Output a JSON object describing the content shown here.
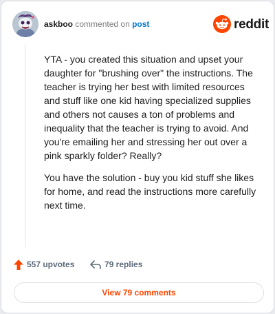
{
  "header": {
    "username": "askboo",
    "action_text": "commented on",
    "target_text": "post",
    "brand": "reddit",
    "avatar_icon": "snoo-avatar-icon",
    "logo_icon": "reddit-snoo-logo-icon"
  },
  "comment": {
    "paragraphs": [
      "YTA - you created this situation and upset your daughter for \"brushing over\" the instructions. The teacher is trying her best with limited resources and stuff like one kid having specialized supplies and others not causes a ton of problems and inequality that the teacher is trying to avoid. And you're emailing her and stressing her out over a pink sparkly folder? Really?",
      "You have the solution - buy you kid stuff she likes for home, and read the instructions more carefully next time."
    ]
  },
  "stats": {
    "upvotes": "557 upvotes",
    "replies": "79 replies",
    "upvote_icon": "upvote-arrow-icon",
    "reply_icon": "reply-arrow-icon"
  },
  "view_button": {
    "label": "View 79 comments"
  },
  "colors": {
    "accent": "#ff4500",
    "link": "#0079d3",
    "text": "#1c1c1c",
    "muted": "#5c6a79"
  }
}
